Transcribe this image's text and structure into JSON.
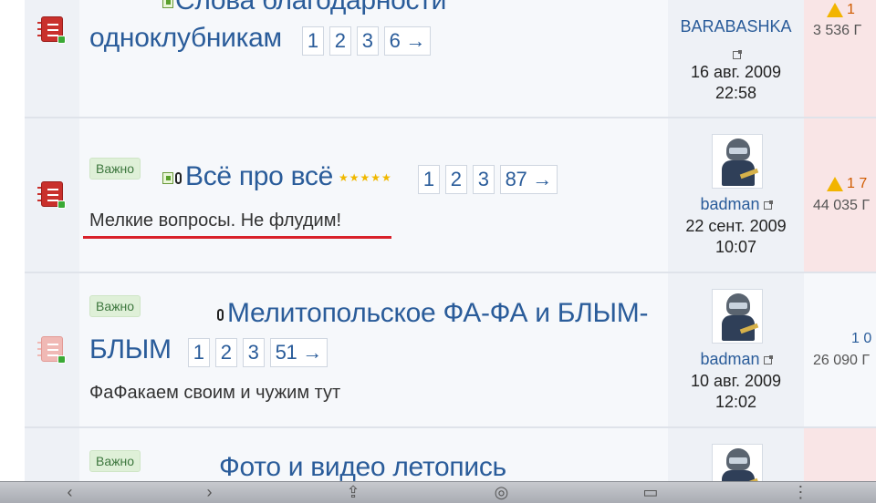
{
  "topics": [
    {
      "title_line1": "Слова благодарности",
      "title_line2": "одноклубникам",
      "pages": [
        "1",
        "2",
        "3",
        "6 →"
      ],
      "author": "BARABASHKA",
      "date": "16 авг. 2009",
      "time": "22:58",
      "stat1": "1",
      "stat2": "3 536 Г"
    },
    {
      "badge": "Важно",
      "title": "Всё про всё",
      "pages": [
        "1",
        "2",
        "3",
        "87 →"
      ],
      "description": "Мелкие вопросы. Не флудим!",
      "author": "badman",
      "date": "22 сент. 2009",
      "time": "10:07",
      "stat1": "1 7",
      "stat2": "44 035 Г"
    },
    {
      "badge": "Важно",
      "title_line1": "Мелитопольское ФА-ФА и БЛЫМ-",
      "title_line2": "БЛЫМ",
      "pages": [
        "1",
        "2",
        "3",
        "51 →"
      ],
      "description": "ФаФакаем своим и чужим тут",
      "author": "badman",
      "date": "10 авг. 2009",
      "time": "12:02",
      "stat1": "1 0",
      "stat2": "26 090 Г"
    },
    {
      "badge": "Важно",
      "title": "Фото и видео летопись"
    }
  ],
  "icons": {
    "topic": "topic-book-icon",
    "new": "new-post-icon",
    "attachment": "paperclip-icon",
    "external": "external-link-icon",
    "warning": "warning-icon",
    "rating": "rating-stars-icon"
  },
  "colors": {
    "link": "#2a5c9a",
    "badge_bg": "#dff0d8",
    "highlight_underline": "#d9212a",
    "warn_cell": "#f9e5e6"
  }
}
